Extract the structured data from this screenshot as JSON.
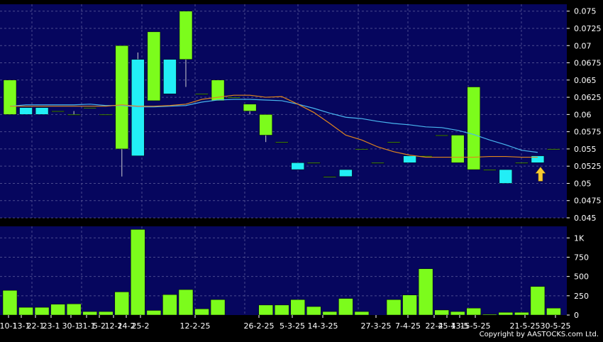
{
  "copyright": "Copyright by AASTOCKS.com Ltd.",
  "colors": {
    "background": "#000000",
    "panel": "#06065e",
    "grid": "#4a4a8e",
    "up_candle": "#7cfc1c",
    "down_candle": "#22eef6",
    "sma_short": "#e0861d",
    "sma_long": "#49b6ef",
    "volume_bar": "#7cfc1c",
    "marker_arrow": "#f5c932"
  },
  "chart_data": [
    {
      "type": "candlestick",
      "ylim": [
        0.045,
        0.076
      ],
      "y_ticks": [
        "0.075",
        "0.0725",
        "0.07",
        "0.0675",
        "0.065",
        "0.0625",
        "0.06",
        "0.0575",
        "0.055",
        "0.0525",
        "0.05",
        "0.0475",
        "0.045"
      ],
      "x_tick_labels": [
        "10-1",
        "13-1",
        "22-1",
        "23-1",
        "30-1",
        "31-1",
        "5-2",
        "12-2",
        "14-2",
        "25-2",
        "12-2-25",
        "26-2-25",
        "5-3-25",
        "14-3-25",
        "27-3-25",
        "7-4-25",
        "22-4",
        "25-4",
        "13-5",
        "15-5-25",
        "21-5-25",
        "30-5-25"
      ],
      "candles": [
        {
          "open": 0.06,
          "high": 0.065,
          "low": 0.06,
          "close": 0.065
        },
        {
          "open": 0.061,
          "high": 0.061,
          "low": 0.06,
          "close": 0.06
        },
        {
          "open": 0.061,
          "high": 0.061,
          "low": 0.06,
          "close": 0.06
        },
        {
          "open": 0.0605,
          "high": 0.0605,
          "low": 0.0605,
          "close": 0.0605
        },
        {
          "open": 0.06,
          "high": 0.0605,
          "low": 0.06,
          "close": 0.06
        },
        {
          "open": 0.061,
          "high": 0.061,
          "low": 0.061,
          "close": 0.061
        },
        {
          "open": 0.06,
          "high": 0.06,
          "low": 0.06,
          "close": 0.06
        },
        {
          "open": 0.055,
          "high": 0.07,
          "low": 0.051,
          "close": 0.07
        },
        {
          "open": 0.068,
          "high": 0.069,
          "low": 0.054,
          "close": 0.054
        },
        {
          "open": 0.062,
          "high": 0.072,
          "low": 0.062,
          "close": 0.072
        },
        {
          "open": 0.068,
          "high": 0.068,
          "low": 0.063,
          "close": 0.063
        },
        {
          "open": 0.068,
          "high": 0.075,
          "low": 0.064,
          "close": 0.075
        },
        {
          "open": 0.063,
          "high": 0.063,
          "low": 0.063,
          "close": 0.063
        },
        {
          "open": 0.062,
          "high": 0.065,
          "low": 0.062,
          "close": 0.065
        },
        {
          "open": 0.0625,
          "high": 0.0625,
          "low": 0.0625,
          "close": 0.0625
        },
        {
          "open": 0.0605,
          "high": 0.0615,
          "low": 0.06,
          "close": 0.0615
        },
        {
          "open": 0.057,
          "high": 0.06,
          "low": 0.056,
          "close": 0.06
        },
        {
          "open": 0.056,
          "high": 0.056,
          "low": 0.056,
          "close": 0.056
        },
        {
          "open": 0.053,
          "high": 0.053,
          "low": 0.052,
          "close": 0.052
        },
        {
          "open": 0.053,
          "high": 0.053,
          "low": 0.053,
          "close": 0.053
        },
        {
          "open": 0.051,
          "high": 0.051,
          "low": 0.051,
          "close": 0.051
        },
        {
          "open": 0.052,
          "high": 0.052,
          "low": 0.051,
          "close": 0.051
        },
        {
          "open": 0.055,
          "high": 0.055,
          "low": 0.055,
          "close": 0.055
        },
        {
          "open": 0.053,
          "high": 0.053,
          "low": 0.053,
          "close": 0.053
        },
        {
          "open": 0.056,
          "high": 0.056,
          "low": 0.056,
          "close": 0.056
        },
        {
          "open": 0.054,
          "high": 0.054,
          "low": 0.053,
          "close": 0.053
        },
        {
          "open": 0.054,
          "high": 0.054,
          "low": 0.054,
          "close": 0.054
        },
        {
          "open": 0.057,
          "high": 0.057,
          "low": 0.057,
          "close": 0.057
        },
        {
          "open": 0.053,
          "high": 0.057,
          "low": 0.053,
          "close": 0.057
        },
        {
          "open": 0.052,
          "high": 0.064,
          "low": 0.052,
          "close": 0.064
        },
        {
          "open": 0.052,
          "high": 0.052,
          "low": 0.052,
          "close": 0.052
        },
        {
          "open": 0.052,
          "high": 0.052,
          "low": 0.05,
          "close": 0.05
        },
        {
          "open": 0.053,
          "high": 0.053,
          "low": 0.053,
          "close": 0.053
        },
        {
          "open": 0.054,
          "high": 0.054,
          "low": 0.053,
          "close": 0.053
        },
        {
          "open": 0.055,
          "high": 0.055,
          "low": 0.055,
          "close": 0.055
        }
      ],
      "sma_short": [
        0.0612,
        0.0612,
        0.0612,
        0.0612,
        0.0612,
        0.0612,
        0.0612,
        0.0614,
        0.0612,
        0.0612,
        0.0613,
        0.0615,
        0.0622,
        0.0625,
        0.0628,
        0.0628,
        0.0625,
        0.0626,
        0.0615,
        0.0603,
        0.0587,
        0.057,
        0.0563,
        0.0553,
        0.0546,
        0.0541,
        0.0538,
        0.0538,
        0.0538,
        0.0538,
        0.0539,
        0.0539,
        0.0538,
        0.0538
      ],
      "sma_long": [
        0.0612,
        0.0614,
        0.0614,
        0.0614,
        0.0614,
        0.0615,
        0.0613,
        0.0613,
        0.0611,
        0.0611,
        0.0612,
        0.0613,
        0.0618,
        0.0621,
        0.0622,
        0.0622,
        0.0621,
        0.062,
        0.0615,
        0.0609,
        0.0602,
        0.0596,
        0.0594,
        0.059,
        0.0587,
        0.0585,
        0.0582,
        0.0581,
        0.0577,
        0.0571,
        0.0563,
        0.0556,
        0.0548,
        0.0545
      ],
      "marker_index": 33
    },
    {
      "type": "bar",
      "ylim": [
        0,
        1150
      ],
      "y_ticks": [
        "1K",
        "750",
        "500",
        "250",
        "0"
      ],
      "values": [
        320,
        100,
        100,
        140,
        145,
        45,
        45,
        300,
        1110,
        60,
        265,
        330,
        80,
        200,
        0,
        0,
        130,
        130,
        200,
        110,
        45,
        215,
        45,
        0,
        200,
        260,
        600,
        65,
        45,
        90,
        10,
        35,
        35,
        370,
        90
      ]
    }
  ]
}
